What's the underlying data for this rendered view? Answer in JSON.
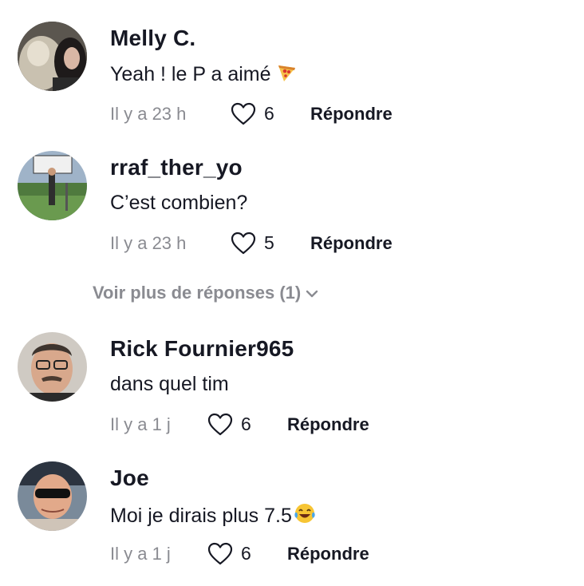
{
  "comments": [
    {
      "username": "Melly C.",
      "text": "Yeah ! le P a aimé",
      "emoji": "pizza-emoji",
      "time": "Il y a 23 h",
      "likes": "6",
      "reply_label": "Répondre"
    },
    {
      "username": "rraf_ther_yo",
      "text": "C’est combien?",
      "time": "Il y a 23 h",
      "likes": "5",
      "reply_label": "Répondre"
    },
    {
      "username": "Rick Fournier965",
      "text": "dans quel tim",
      "time": "Il y a 1 j",
      "likes": "6",
      "reply_label": "Répondre"
    },
    {
      "username": "Joe",
      "text": "Moi je dirais plus 7.5",
      "emoji": "laughing-tears-emoji",
      "time": "Il y a 1 j",
      "likes": "6",
      "reply_label": "Répondre"
    }
  ],
  "more_replies": {
    "label": "Voir plus de réponses (1)",
    "icon": "chevron-down-icon"
  },
  "colors": {
    "primary_text": "#161823",
    "secondary_text": "#8a8b91",
    "background": "#ffffff"
  }
}
